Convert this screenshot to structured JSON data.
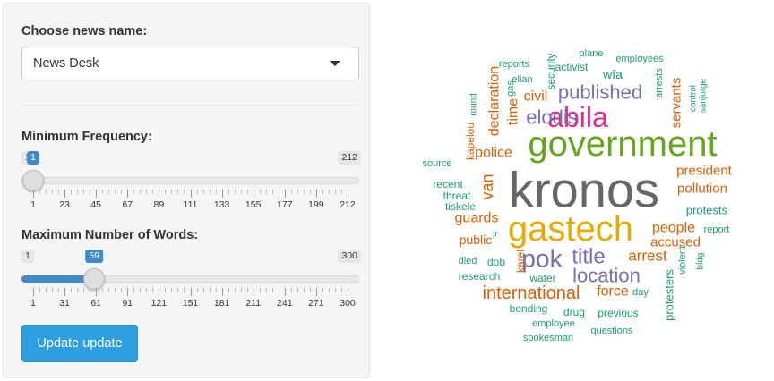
{
  "controls": {
    "news_label": "Choose news name:",
    "news_selected": "News Desk",
    "min_freq": {
      "label": "Minimum Frequency:",
      "min": 1,
      "max": 212,
      "value": 1,
      "min_text": "1",
      "max_text": "212",
      "value_text": "1",
      "tick_labels": [
        "1",
        "23",
        "45",
        "67",
        "89",
        "111",
        "133",
        "155",
        "177",
        "199",
        "212"
      ]
    },
    "max_words": {
      "label": "Maximum Number of Words:",
      "min": 1,
      "max": 300,
      "value": 59,
      "min_text": "1",
      "max_text": "300",
      "value_text": "59",
      "tick_labels": [
        "1",
        "31",
        "61",
        "91",
        "121",
        "151",
        "181",
        "211",
        "241",
        "271",
        "300"
      ]
    },
    "update_button": "Update update"
  },
  "colors": {
    "orange": "#d95f02",
    "green": "#1b9e77",
    "purple": "#7570b3",
    "magenta": "#e7298a",
    "lime": "#66a61e",
    "gold": "#e6ab02",
    "gray": "#666666"
  },
  "wordcloud": [
    {
      "text": "kronos",
      "size": 56,
      "color": "gray",
      "rotate": 0
    },
    {
      "text": "government",
      "size": 40,
      "color": "lime",
      "rotate": 0
    },
    {
      "text": "gastech",
      "size": 40,
      "color": "gold",
      "rotate": 0
    },
    {
      "text": "abila",
      "size": 32,
      "color": "magenta",
      "rotate": 0
    },
    {
      "text": "published",
      "size": 22,
      "color": "purple",
      "rotate": 0
    },
    {
      "text": "elodis",
      "size": 22,
      "color": "purple",
      "rotate": 0
    },
    {
      "text": "pok",
      "size": 28,
      "color": "purple",
      "rotate": 0
    },
    {
      "text": "title",
      "size": 24,
      "color": "purple",
      "rotate": 0
    },
    {
      "text": "location",
      "size": 22,
      "color": "purple",
      "rotate": 0
    },
    {
      "text": "international",
      "size": 20,
      "color": "orange",
      "rotate": 0
    },
    {
      "text": "police",
      "size": 16,
      "color": "orange",
      "rotate": 0
    },
    {
      "text": "time",
      "size": 16,
      "color": "orange",
      "rotate": -90
    },
    {
      "text": "civil",
      "size": 16,
      "color": "orange",
      "rotate": 0
    },
    {
      "text": "declaration",
      "size": 16,
      "color": "orange",
      "rotate": -90
    },
    {
      "text": "servants",
      "size": 15,
      "color": "orange",
      "rotate": -90
    },
    {
      "text": "president",
      "size": 15,
      "color": "orange",
      "rotate": 0
    },
    {
      "text": "pollution",
      "size": 15,
      "color": "orange",
      "rotate": 0
    },
    {
      "text": "people",
      "size": 16,
      "color": "orange",
      "rotate": 0
    },
    {
      "text": "accused",
      "size": 15,
      "color": "orange",
      "rotate": 0
    },
    {
      "text": "arrest",
      "size": 17,
      "color": "orange",
      "rotate": 0
    },
    {
      "text": "force",
      "size": 16,
      "color": "orange",
      "rotate": 0
    },
    {
      "text": "guards",
      "size": 16,
      "color": "orange",
      "rotate": 0
    },
    {
      "text": "van",
      "size": 18,
      "color": "orange",
      "rotate": -90
    },
    {
      "text": "public",
      "size": 14,
      "color": "orange",
      "rotate": 0
    },
    {
      "text": "kapelou",
      "size": 12,
      "color": "orange",
      "rotate": -90
    },
    {
      "text": "karel",
      "size": 12,
      "color": "orange",
      "rotate": -90
    },
    {
      "text": "protests",
      "size": 13,
      "color": "green",
      "rotate": 0
    },
    {
      "text": "protesters",
      "size": 13,
      "color": "green",
      "rotate": -90
    },
    {
      "text": "reports",
      "size": 11,
      "color": "green",
      "rotate": 0
    },
    {
      "text": "activist",
      "size": 12,
      "color": "green",
      "rotate": 0
    },
    {
      "text": "plane",
      "size": 11,
      "color": "green",
      "rotate": 0
    },
    {
      "text": "employees",
      "size": 11,
      "color": "green",
      "rotate": 0
    },
    {
      "text": "wfa",
      "size": 14,
      "color": "green",
      "rotate": 0
    },
    {
      "text": "security",
      "size": 12,
      "color": "green",
      "rotate": -90
    },
    {
      "text": "elian",
      "size": 11,
      "color": "green",
      "rotate": 0
    },
    {
      "text": "gas",
      "size": 11,
      "color": "green",
      "rotate": -90
    },
    {
      "text": "arrests",
      "size": 11,
      "color": "green",
      "rotate": -90
    },
    {
      "text": "control",
      "size": 10,
      "color": "green",
      "rotate": -90
    },
    {
      "text": "sanjorge",
      "size": 10,
      "color": "green",
      "rotate": -90
    },
    {
      "text": "round",
      "size": 10,
      "color": "green",
      "rotate": -90
    },
    {
      "text": "source",
      "size": 11,
      "color": "green",
      "rotate": 0
    },
    {
      "text": "recent",
      "size": 12,
      "color": "green",
      "rotate": 0
    },
    {
      "text": "threat",
      "size": 12,
      "color": "green",
      "rotate": 0
    },
    {
      "text": "tiskele",
      "size": 12,
      "color": "green",
      "rotate": 0
    },
    {
      "text": "report",
      "size": 11,
      "color": "green",
      "rotate": 0
    },
    {
      "text": "violent",
      "size": 11,
      "color": "green",
      "rotate": -90
    },
    {
      "text": "bldg",
      "size": 10,
      "color": "green",
      "rotate": -90
    },
    {
      "text": "jr",
      "size": 10,
      "color": "green",
      "rotate": 0
    },
    {
      "text": "died",
      "size": 11,
      "color": "green",
      "rotate": 0
    },
    {
      "text": "dob",
      "size": 12,
      "color": "green",
      "rotate": 0
    },
    {
      "text": "research",
      "size": 12,
      "color": "green",
      "rotate": 0
    },
    {
      "text": "water",
      "size": 12,
      "color": "green",
      "rotate": 0
    },
    {
      "text": "day",
      "size": 11,
      "color": "green",
      "rotate": 0
    },
    {
      "text": "bending",
      "size": 12,
      "color": "green",
      "rotate": 0
    },
    {
      "text": "drug",
      "size": 12,
      "color": "green",
      "rotate": 0
    },
    {
      "text": "previous",
      "size": 12,
      "color": "green",
      "rotate": 0
    },
    {
      "text": "employee",
      "size": 11,
      "color": "green",
      "rotate": 0
    },
    {
      "text": "spokesman",
      "size": 11,
      "color": "green",
      "rotate": 0
    },
    {
      "text": "questions",
      "size": 11,
      "color": "green",
      "rotate": 0
    }
  ]
}
